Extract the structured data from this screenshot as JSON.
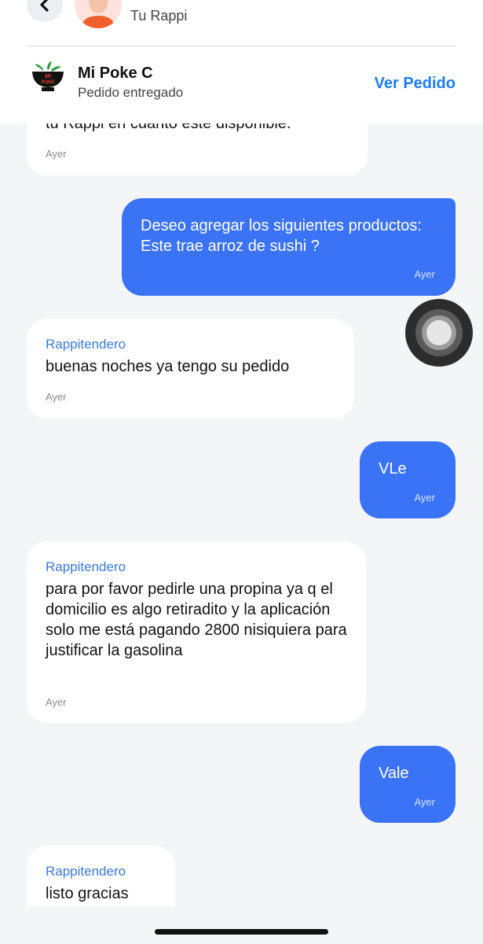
{
  "header": {
    "title": "Tu Rappi",
    "store_name": "Mi Poke C",
    "store_status": "Pedido entregado",
    "action_label": "Ver Pedido",
    "logo_text": "MI POKE"
  },
  "messages": [
    {
      "side": "in",
      "text": "tu Rappi en cuanto esté disponible.",
      "time": "Ayer"
    },
    {
      "side": "out",
      "text": "Deseo agregar los siguientes productos: Este trae arroz de sushi ?",
      "time": "Ayer"
    },
    {
      "side": "in",
      "sender": "Rappitendero",
      "text": "buenas noches ya tengo su pedido",
      "time": "Ayer"
    },
    {
      "side": "out",
      "text": "VLe",
      "time": "Ayer"
    },
    {
      "side": "in",
      "sender": "Rappitendero",
      "text": "para por favor pedirle una propina ya q el domicilio es algo retiradito y la aplicación solo me está pagando 2800 nisiquiera para justificar la gasolina",
      "time": "Ayer"
    },
    {
      "side": "out",
      "text": "Vale",
      "time": "Ayer"
    },
    {
      "side": "in",
      "sender": "Rappitendero",
      "text": "listo gracias"
    }
  ],
  "colors": {
    "accent": "#1d7df0",
    "outgoing_bubble": "#3b73f7",
    "incoming_bubble": "#ffffff",
    "sender_label": "#3a7bd5",
    "background": "#f4f5f7"
  }
}
